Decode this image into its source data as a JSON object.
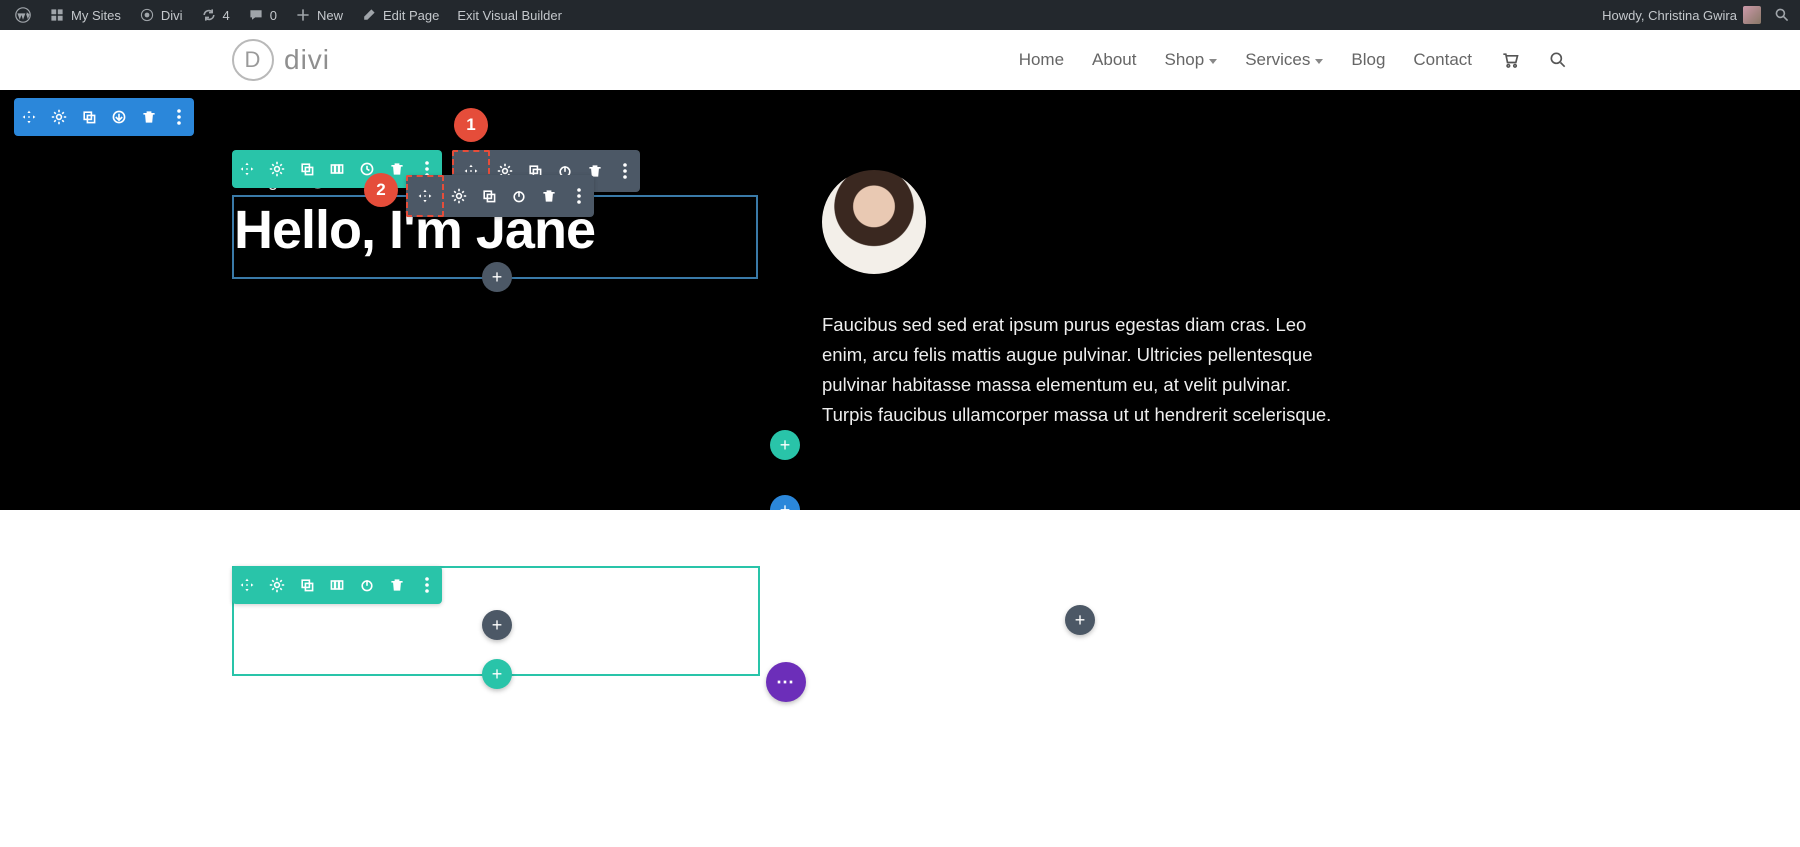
{
  "adminbar": {
    "my_sites": "My Sites",
    "site_name": "Divi",
    "updates": "4",
    "comments": "0",
    "new": "New",
    "edit_page": "Edit Page",
    "exit_vb": "Exit Visual Builder",
    "greeting": "Howdy, Christina Gwira"
  },
  "nav": {
    "logo_text": "divi",
    "items": [
      {
        "label": "Home",
        "dropdown": false
      },
      {
        "label": "About",
        "dropdown": false
      },
      {
        "label": "Shop",
        "dropdown": true
      },
      {
        "label": "Services",
        "dropdown": true
      },
      {
        "label": "Blog",
        "dropdown": false
      },
      {
        "label": "Contact",
        "dropdown": false
      }
    ]
  },
  "hero": {
    "subtitle": "Designer @ DIVI",
    "title": "Hello, I'm Jane",
    "bio": "Faucibus sed sed erat ipsum purus egestas diam cras. Leo enim, arcu felis mattis augue pulvinar. Ultricies pellentesque pulvinar habitasse massa elementum eu, at velit pulvinar. Turpis faucibus ullamcorper massa ut ut hendrerit scelerisque."
  },
  "annotations": {
    "badge1": "1",
    "badge2": "2"
  },
  "add_symbol": "+",
  "dots_symbol": "⋯"
}
